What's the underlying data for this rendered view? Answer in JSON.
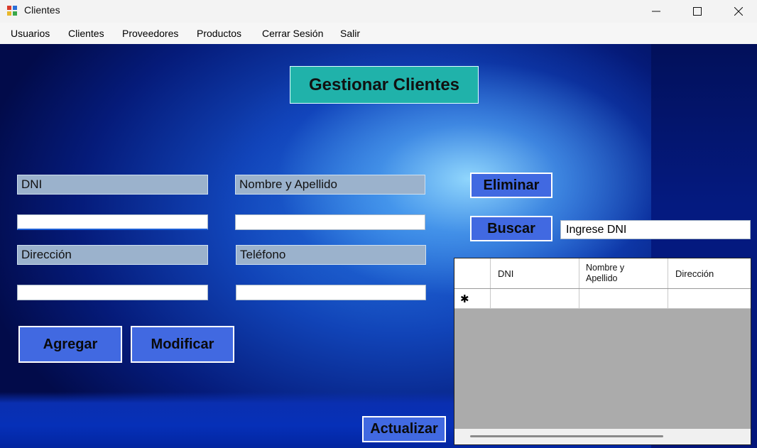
{
  "window": {
    "title": "Clientes"
  },
  "menu": [
    "Usuarios",
    "Clientes",
    "Proveedores",
    "Productos",
    "Cerrar Sesión",
    "Salir"
  ],
  "form": {
    "header": "Gestionar Clientes",
    "labels": {
      "dni": "DNI",
      "nombre": "Nombre y Apellido",
      "direccion": "Dirección",
      "telefono": "Teléfono"
    },
    "values": {
      "dni": "",
      "nombre": "",
      "direccion": "",
      "telefono": ""
    },
    "buttons": {
      "agregar": "Agregar",
      "modificar": "Modificar",
      "eliminar": "Eliminar",
      "buscar": "Buscar",
      "actualizar": "Actualizar"
    },
    "search_value": "Ingrese DNI"
  },
  "grid": {
    "columns": [
      "DNI",
      "Nombre y\nApellido",
      "Dirección"
    ],
    "new_row_marker": "✱"
  },
  "colors": {
    "header_bg": "#20b2aa",
    "button_bg": "#4169e1",
    "label_bg": "#9bb2cc"
  }
}
